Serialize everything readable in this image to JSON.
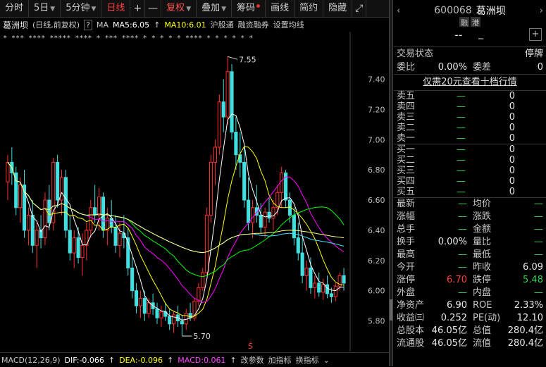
{
  "toolbar": {
    "items": [
      "分时",
      "5日",
      "5分钟",
      "日线",
      "十",
      "一",
      "复权",
      "叠加",
      "筹码",
      "画线",
      "简约",
      "隐藏"
    ],
    "active": "日线"
  },
  "infobar": {
    "name": "葛洲坝",
    "mode": "(日线,前复权)",
    "help": "?",
    "ma_label": "MA",
    "ma5": "MA5:6.05",
    "ma10": "MA10:6.01",
    "hgt": "沪股通",
    "rzrq": "融资融券",
    "set_ma": "设置均线"
  },
  "chart_data": {
    "type": "candlestick",
    "title": "",
    "y_ticks": [
      "7.40",
      "7.20",
      "7.00",
      "6.80",
      "6.60",
      "6.40",
      "6.20",
      "6.00",
      "5.80"
    ],
    "ylim": [
      5.7,
      7.55
    ],
    "annotations": [
      {
        "text": "7.55",
        "x_index": 53,
        "price": 7.55
      },
      {
        "text": "5.70",
        "x_index": 42,
        "price": 5.7
      }
    ],
    "ohlc": [
      [
        6.72,
        6.9,
        6.6,
        6.85
      ],
      [
        6.85,
        6.95,
        6.7,
        6.78
      ],
      [
        6.78,
        6.82,
        6.5,
        6.55
      ],
      [
        6.55,
        6.75,
        6.45,
        6.7
      ],
      [
        6.7,
        6.8,
        6.35,
        6.4
      ],
      [
        6.4,
        6.55,
        6.3,
        6.5
      ],
      [
        6.5,
        6.6,
        6.25,
        6.3
      ],
      [
        6.3,
        6.45,
        6.15,
        6.4
      ],
      [
        6.4,
        6.5,
        6.28,
        6.35
      ],
      [
        6.35,
        6.65,
        6.3,
        6.6
      ],
      [
        6.6,
        6.7,
        6.4,
        6.45
      ],
      [
        6.45,
        6.88,
        6.4,
        6.85
      ],
      [
        6.85,
        6.9,
        6.55,
        6.6
      ],
      [
        6.6,
        6.8,
        6.5,
        6.75
      ],
      [
        6.75,
        6.8,
        6.35,
        6.4
      ],
      [
        6.4,
        6.5,
        6.2,
        6.25
      ],
      [
        6.25,
        6.4,
        6.15,
        6.35
      ],
      [
        6.35,
        6.42,
        6.18,
        6.22
      ],
      [
        6.22,
        6.38,
        6.1,
        6.3
      ],
      [
        6.3,
        6.45,
        6.2,
        6.4
      ],
      [
        6.4,
        6.6,
        6.35,
        6.55
      ],
      [
        6.55,
        6.7,
        6.45,
        6.5
      ],
      [
        6.5,
        6.68,
        6.4,
        6.62
      ],
      [
        6.62,
        6.65,
        6.35,
        6.4
      ],
      [
        6.4,
        6.55,
        6.3,
        6.48
      ],
      [
        6.48,
        6.6,
        6.38,
        6.42
      ],
      [
        6.42,
        6.5,
        6.25,
        6.3
      ],
      [
        6.3,
        6.45,
        6.22,
        6.38
      ],
      [
        6.38,
        6.5,
        6.28,
        6.35
      ],
      [
        6.35,
        6.42,
        6.1,
        6.15
      ],
      [
        6.15,
        6.22,
        5.95,
        6.0
      ],
      [
        6.0,
        6.05,
        5.85,
        5.9
      ],
      [
        5.9,
        6.0,
        5.82,
        5.95
      ],
      [
        5.95,
        6.0,
        5.8,
        5.85
      ],
      [
        5.85,
        5.95,
        5.82,
        5.92
      ],
      [
        5.92,
        5.98,
        5.84,
        5.88
      ],
      [
        5.88,
        5.92,
        5.78,
        5.82
      ],
      [
        5.82,
        5.9,
        5.76,
        5.86
      ],
      [
        5.86,
        5.92,
        5.8,
        5.83
      ],
      [
        5.83,
        5.88,
        5.74,
        5.78
      ],
      [
        5.78,
        5.86,
        5.72,
        5.84
      ],
      [
        5.84,
        5.9,
        5.76,
        5.8
      ],
      [
        5.8,
        5.84,
        5.7,
        5.78
      ],
      [
        5.78,
        5.88,
        5.74,
        5.85
      ],
      [
        5.85,
        5.92,
        5.8,
        5.82
      ],
      [
        5.82,
        5.95,
        5.8,
        5.93
      ],
      [
        5.93,
        6.05,
        5.9,
        6.02
      ],
      [
        6.02,
        6.15,
        6.0,
        6.12
      ],
      [
        6.12,
        6.55,
        6.1,
        6.5
      ],
      [
        6.5,
        6.9,
        6.45,
        6.85
      ],
      [
        6.85,
        7.0,
        6.7,
        6.95
      ],
      [
        6.95,
        7.3,
        6.9,
        7.25
      ],
      [
        7.25,
        7.4,
        7.05,
        7.15
      ],
      [
        7.15,
        7.55,
        7.1,
        7.45
      ],
      [
        7.45,
        7.5,
        7.0,
        7.05
      ],
      [
        7.05,
        7.15,
        6.8,
        6.9
      ],
      [
        6.9,
        7.05,
        6.75,
        6.85
      ],
      [
        6.85,
        6.95,
        6.55,
        6.6
      ],
      [
        6.6,
        6.75,
        6.4,
        6.45
      ],
      [
        6.45,
        6.6,
        6.35,
        6.55
      ],
      [
        6.55,
        6.7,
        6.45,
        6.5
      ],
      [
        6.5,
        6.58,
        6.38,
        6.42
      ],
      [
        6.42,
        6.55,
        6.35,
        6.52
      ],
      [
        6.52,
        6.62,
        6.45,
        6.48
      ],
      [
        6.48,
        6.6,
        6.4,
        6.55
      ],
      [
        6.55,
        6.7,
        6.5,
        6.65
      ],
      [
        6.65,
        6.82,
        6.55,
        6.78
      ],
      [
        6.78,
        6.8,
        6.55,
        6.6
      ],
      [
        6.6,
        6.65,
        6.45,
        6.5
      ],
      [
        6.5,
        6.55,
        6.3,
        6.35
      ],
      [
        6.35,
        6.45,
        6.2,
        6.25
      ],
      [
        6.25,
        6.35,
        6.05,
        6.1
      ],
      [
        6.1,
        6.2,
        6.0,
        6.15
      ],
      [
        6.15,
        6.22,
        5.98,
        6.02
      ],
      [
        6.02,
        6.1,
        5.95,
        6.05
      ],
      [
        6.05,
        6.12,
        5.96,
        5.99
      ],
      [
        5.99,
        6.08,
        5.94,
        6.04
      ],
      [
        6.04,
        6.1,
        5.95,
        5.98
      ],
      [
        5.98,
        6.02,
        5.92,
        5.96
      ],
      [
        5.96,
        6.05,
        5.93,
        6.03
      ],
      [
        6.03,
        6.12,
        6.0,
        6.1
      ],
      [
        6.1,
        6.15,
        6.0,
        6.05
      ]
    ],
    "ma5_color": "#ffffff",
    "ma10_color": "#ffff00",
    "ma20_color": "#ff00ff",
    "ma30_color": "#00ff00",
    "ma60_color": "#40e0ff",
    "ma120_color": "#ffff80",
    "up_color": "#ff3030",
    "down_color": "#40e0e0"
  },
  "bottombar": {
    "macd_title": "MACD(12,26,9)",
    "dif": "DIF:-0.066",
    "dea": "DEA:-0.096",
    "macd": "MACD:0.061",
    "change_param": "改参数",
    "add_ind": "加指标",
    "swap_ind": "换指标"
  },
  "panel": {
    "code": "600068",
    "name": "葛洲坝",
    "tag1": "融",
    "tag2": "港",
    "price": "--",
    "trade_status_label": "交易状态",
    "trade_status_value": "停牌",
    "weibi_label": "委比",
    "weibi_value": "0.00%",
    "weicha_label": "委差",
    "weicha_value": "0",
    "promo": "仅需20元查看十档行情",
    "sell": [
      {
        "label": "卖五",
        "price": "—",
        "vol": "0"
      },
      {
        "label": "卖四",
        "price": "—",
        "vol": "0"
      },
      {
        "label": "卖三",
        "price": "—",
        "vol": "0"
      },
      {
        "label": "卖二",
        "price": "—",
        "vol": "0"
      },
      {
        "label": "卖一",
        "price": "—",
        "vol": "0"
      }
    ],
    "buy": [
      {
        "label": "买一",
        "price": "—",
        "vol": "0"
      },
      {
        "label": "买二",
        "price": "—",
        "vol": "0"
      },
      {
        "label": "买三",
        "price": "—",
        "vol": "0"
      },
      {
        "label": "买四",
        "price": "—",
        "vol": "0"
      },
      {
        "label": "买五",
        "price": "—",
        "vol": "0"
      }
    ],
    "stats": [
      [
        "最新",
        "—",
        "均价",
        "—"
      ],
      [
        "涨幅",
        "—",
        "涨跌",
        "—"
      ],
      [
        "总手",
        "—",
        "金额",
        "—"
      ],
      [
        "换手",
        "0.00%",
        "量比",
        "—"
      ],
      [
        "最高",
        "—",
        "最低",
        "—"
      ],
      [
        "今开",
        "—",
        "昨收",
        "6.09"
      ],
      [
        "涨停",
        "6.70",
        "跌停",
        "5.48"
      ],
      [
        "外盘",
        "—",
        "内盘",
        "—"
      ],
      [
        "净资产",
        "6.90",
        "ROE",
        "2.33%"
      ],
      [
        "收益㈢",
        "0.252",
        "PE(动)",
        "12.10"
      ],
      [
        "总股本",
        "46.05亿",
        "总值",
        "280.4亿"
      ],
      [
        "流通股",
        "46.05亿",
        "流值",
        "280.4亿"
      ]
    ]
  }
}
